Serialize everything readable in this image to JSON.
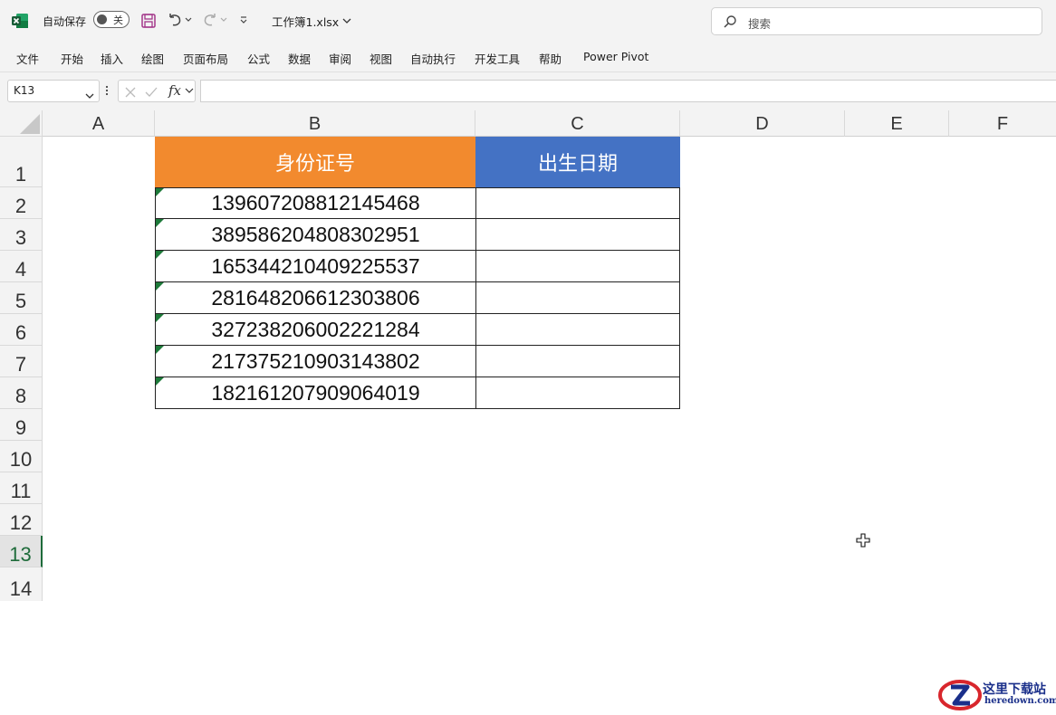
{
  "titlebar": {
    "autosave_label": "自动保存",
    "autosave_state": "关",
    "workbook_name": "工作簿1.xlsx",
    "brand_color": "#1e7a3a"
  },
  "search": {
    "placeholder": "搜索"
  },
  "ribbon": {
    "tabs": [
      "文件",
      "开始",
      "插入",
      "绘图",
      "页面布局",
      "公式",
      "数据",
      "审阅",
      "视图",
      "自动执行",
      "开发工具",
      "帮助",
      "Power Pivot"
    ]
  },
  "formula_bar": {
    "name_box": "K13",
    "formula": ""
  },
  "sheet": {
    "columns": [
      "A",
      "B",
      "C",
      "D",
      "E",
      "F"
    ],
    "rows": [
      "1",
      "2",
      "3",
      "4",
      "5",
      "6",
      "7",
      "8",
      "9",
      "10",
      "11",
      "12",
      "13",
      "14"
    ],
    "active_row": "13",
    "table": {
      "header_id": "身份证号",
      "header_birth": "出生日期",
      "header_id_color": "#f28a2e",
      "header_birth_color": "#4472c4",
      "ids": [
        "139607208812145468",
        "389586204808302951",
        "165344210409225537",
        "281648206612303806",
        "327238206002221284",
        "217375210903143802",
        "182161207909064019"
      ]
    }
  },
  "watermark": {
    "text": "这里下载站",
    "url": "heredown.com"
  }
}
